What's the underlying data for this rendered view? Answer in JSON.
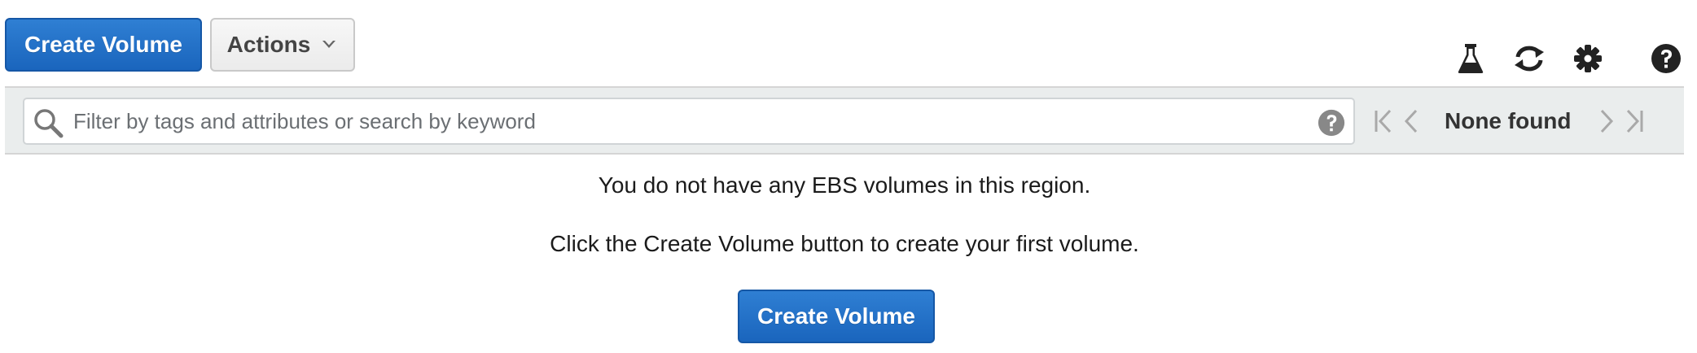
{
  "toolbar": {
    "create_volume_label": "Create Volume",
    "actions_label": "Actions",
    "icons": [
      "flask-icon",
      "refresh-icon",
      "gear-icon",
      "help-icon"
    ]
  },
  "filter": {
    "placeholder": "Filter by tags and attributes or search by keyword",
    "value": ""
  },
  "pagination": {
    "status": "None found"
  },
  "empty_state": {
    "message": "You do not have any EBS volumes in this region.",
    "instruction": "Click the Create Volume button to create your first volume.",
    "button_label": "Create Volume"
  },
  "colors": {
    "primary": "#1a65bd",
    "primary_border": "#1557a6",
    "filter_bar_bg": "#eaeded",
    "icon_dark": "#222222",
    "icon_muted": "#a9a9a9"
  }
}
